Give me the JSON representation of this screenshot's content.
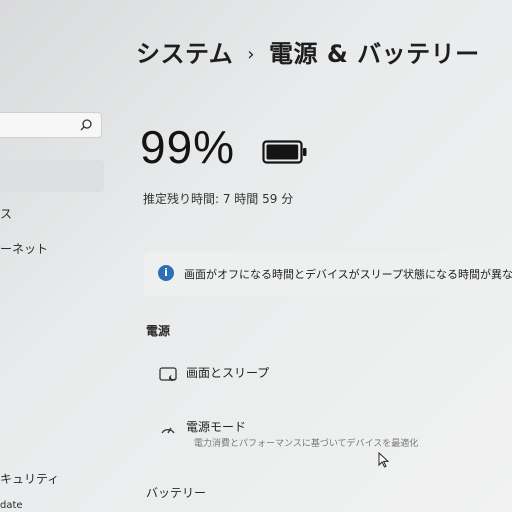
{
  "sidebar": {
    "items": [
      {
        "label": "ス"
      },
      {
        "label": "ーネット"
      },
      {
        "label": "キュリティ"
      },
      {
        "label": "date"
      }
    ]
  },
  "breadcrumb": {
    "parent": "システム",
    "separator": "›",
    "current": "電源 & バッテリー"
  },
  "battery": {
    "percent": "99%",
    "remaining": "推定残り時間: 7 時間 59 分",
    "level": 0.99
  },
  "info_banner": {
    "icon": "info-icon",
    "text": "画面がオフになる時間とデバイスがスリープ状態になる時間が異なるた"
  },
  "power_section": {
    "title": "電源",
    "items": [
      {
        "icon": "screen-sleep-icon",
        "label": "画面とスリープ"
      },
      {
        "icon": "power-mode-icon",
        "label": "電源モード",
        "sublabel": "電力消費とパフォーマンスに基づいてデバイスを最適化"
      }
    ]
  },
  "battery_section": {
    "title": "バッテリー"
  }
}
